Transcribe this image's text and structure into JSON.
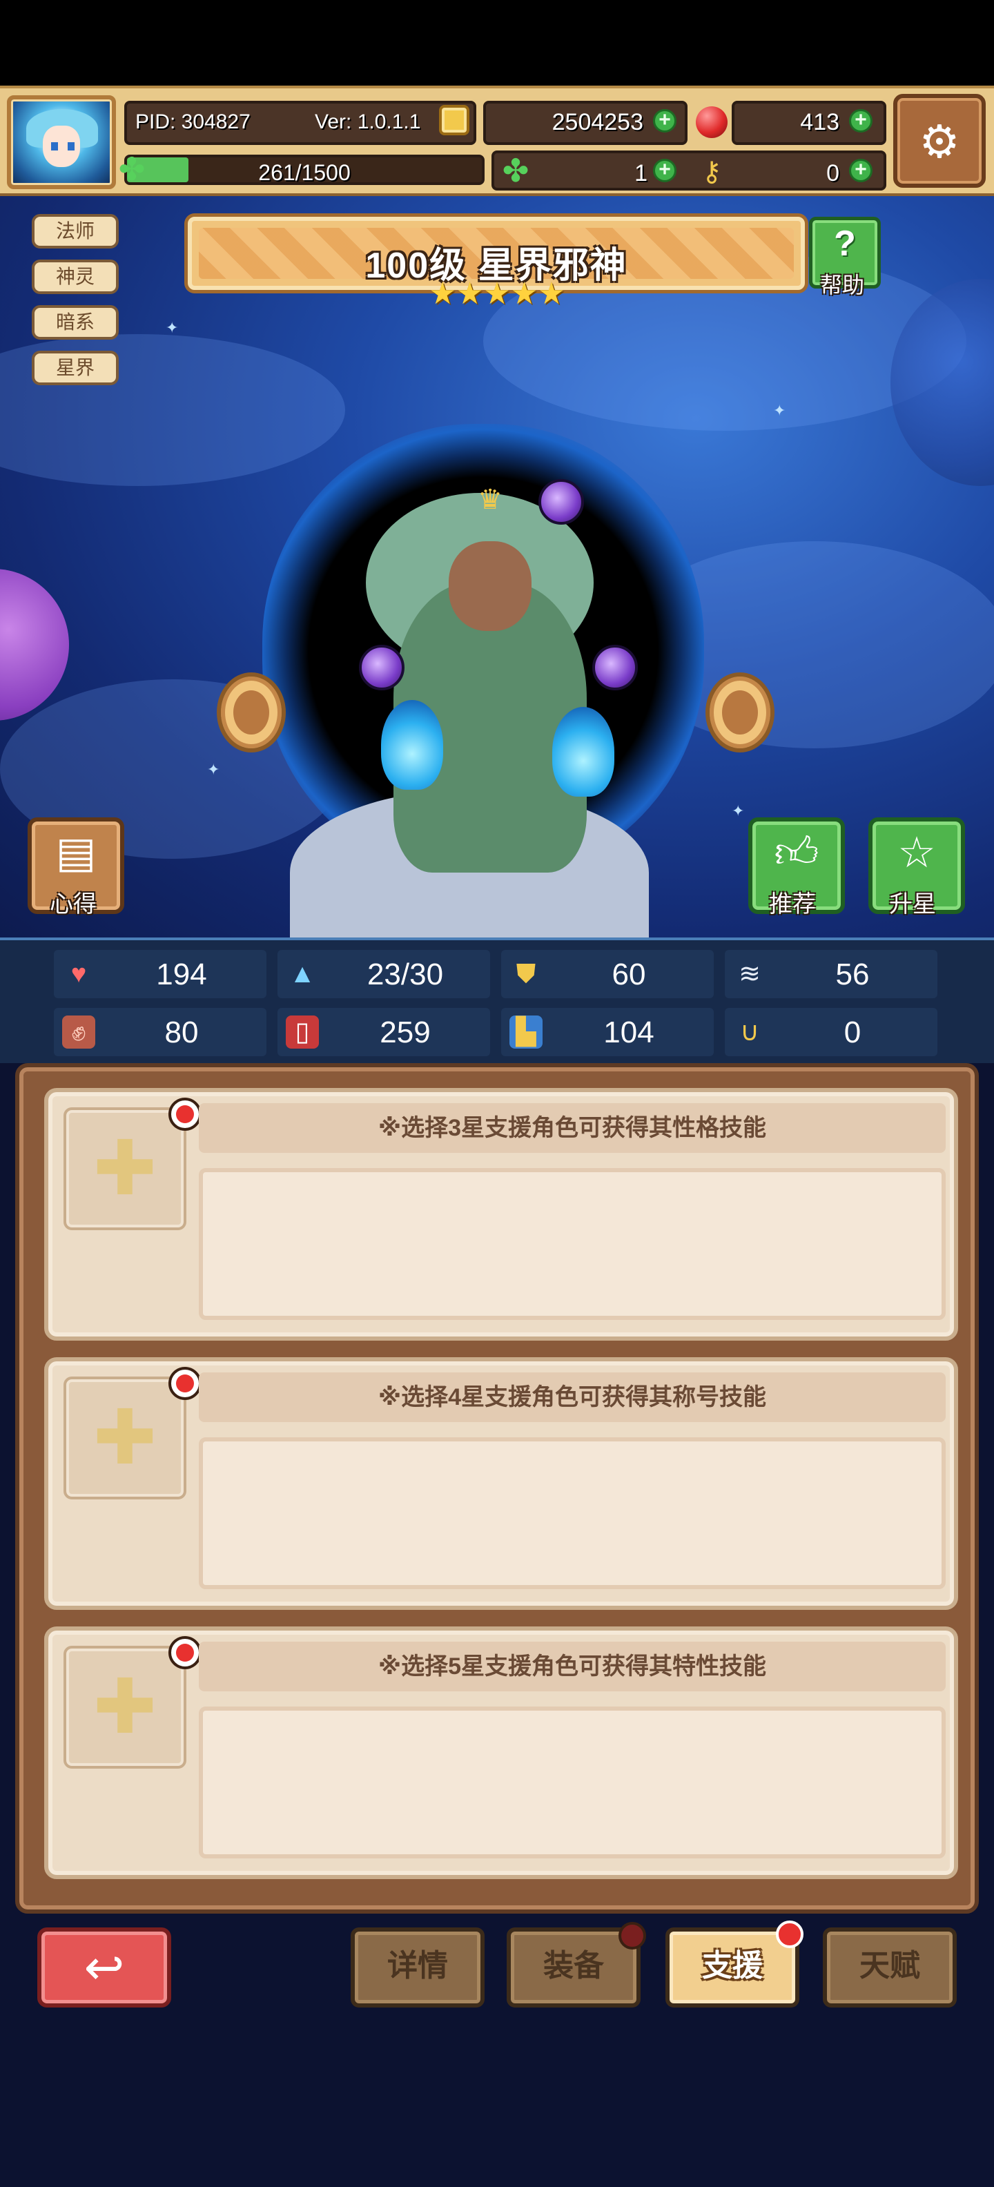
{
  "header": {
    "pid": "PID: 304827",
    "version": "Ver: 1.0.1.1",
    "gold": "2504253",
    "gems": "413",
    "clovers": "1",
    "keys": "0",
    "exp_text": "261/1500",
    "exp_progress": 0.174
  },
  "character": {
    "tags": [
      "法师",
      "神灵",
      "暗系",
      "星界"
    ],
    "title": "100级  星界邪神",
    "stars": 5,
    "help_label": "帮助",
    "notes_label": "心得",
    "recommend_label": "推荐",
    "star_up_label": "升星"
  },
  "stats": [
    {
      "icon": "heart-icon",
      "value": "194"
    },
    {
      "icon": "water-drop-icon",
      "value": "23/30"
    },
    {
      "icon": "shield-icon",
      "value": "60"
    },
    {
      "icon": "wing-icon",
      "value": "56"
    },
    {
      "icon": "fist-icon",
      "value": "80"
    },
    {
      "icon": "book-icon",
      "value": "259"
    },
    {
      "icon": "boot-icon",
      "value": "104"
    },
    {
      "icon": "magnet-icon",
      "value": "0"
    }
  ],
  "support": {
    "slots": [
      {
        "header": "※选择3星支援角色可获得其性格技能"
      },
      {
        "header": "※选择4星支援角色可获得其称号技能"
      },
      {
        "header": "※选择5星支援角色可获得其特性技能"
      }
    ]
  },
  "nav": {
    "tabs": [
      {
        "label": "详情",
        "active": false,
        "badge": false
      },
      {
        "label": "装备",
        "active": false,
        "badge": true
      },
      {
        "label": "支援",
        "active": true,
        "badge": true
      },
      {
        "label": "天赋",
        "active": false,
        "badge": false
      }
    ]
  },
  "colors": {
    "accent_green": "#4fb54c",
    "badge_red": "#e8312f",
    "panel_brown": "#8a5a3a",
    "tab_active": "#f2cf8f"
  }
}
